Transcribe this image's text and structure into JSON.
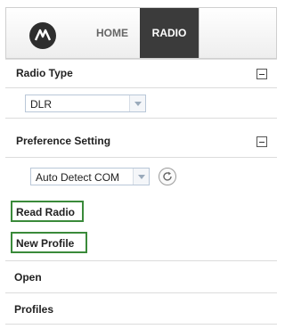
{
  "header": {
    "tabs": {
      "home": "HOME",
      "radio": "RADIO"
    },
    "active_tab": "RADIO",
    "logo_icon": "motorola-logo-icon"
  },
  "sections": {
    "radio_type": {
      "label": "Radio Type",
      "selected": "DLR"
    },
    "preference_setting": {
      "label": "Preference Setting",
      "selected": "Auto Detect COM"
    }
  },
  "actions": {
    "read_radio": "Read Radio",
    "new_profile": "New Profile",
    "open": "Open",
    "profiles": "Profiles"
  },
  "colors": {
    "active_tab_bg": "#3b3b3b",
    "highlight_border": "#3a8a3a"
  }
}
